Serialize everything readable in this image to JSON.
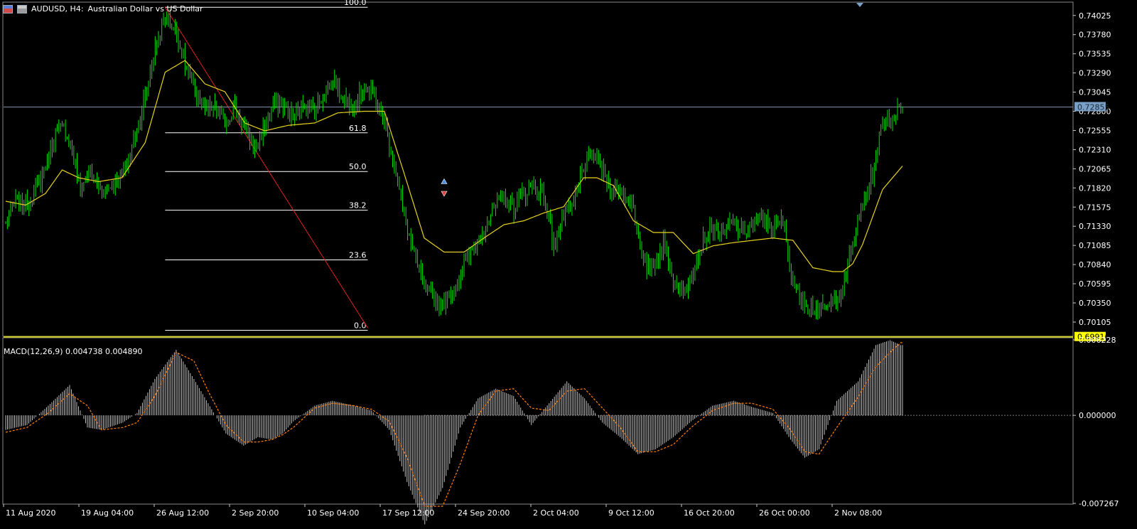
{
  "header": {
    "symbol": "AUDUSD, H4:",
    "description": "Australian Dollar vs US Dollar"
  },
  "macd_header": {
    "label": "MACD(12,26,9) 0.004738 0.004890"
  },
  "colors": {
    "background": "#000000",
    "candle": "#00e000",
    "ma": "#e6d21e",
    "fib": "#ffffff",
    "trend": "#e01e1e",
    "macd_hist": "#c0c0c0",
    "signal": "#ff7f00",
    "current_price_label_bg": "#7aa0c8",
    "fixed_price_label_bg": "#ffff00"
  },
  "chart_data": [
    {
      "type": "candlestick",
      "symbol": "AUDUSD",
      "timeframe": "H4",
      "ylim": [
        0.6995,
        0.7415
      ],
      "y_ticks": [
        "0.74025",
        "0.73780",
        "0.73535",
        "0.73290",
        "0.73045",
        "0.72800",
        "0.72555",
        "0.72310",
        "0.72065",
        "0.71820",
        "0.71575",
        "0.71330",
        "0.71085",
        "0.70840",
        "0.70595",
        "0.70350",
        "0.70105"
      ],
      "x_ticks": [
        "11 Aug 2020",
        "19 Aug 04:00",
        "26 Aug 12:00",
        "2 Sep 20:00",
        "10 Sep 04:00",
        "17 Sep 12:00",
        "24 Sep 20:00",
        "2 Oct 04:00",
        "9 Oct 12:00",
        "16 Oct 20:00",
        "26 Oct 00:00",
        "2 Nov 08:00"
      ],
      "close_anchors": [
        [
          0,
          0.7135
        ],
        [
          6,
          0.7165
        ],
        [
          12,
          0.716
        ],
        [
          18,
          0.7178
        ],
        [
          24,
          0.721
        ],
        [
          30,
          0.725
        ],
        [
          35,
          0.726
        ],
        [
          40,
          0.723
        ],
        [
          45,
          0.718
        ],
        [
          50,
          0.7205
        ],
        [
          55,
          0.7185
        ],
        [
          60,
          0.718
        ],
        [
          66,
          0.719
        ],
        [
          72,
          0.7205
        ],
        [
          78,
          0.725
        ],
        [
          84,
          0.73
        ],
        [
          90,
          0.736
        ],
        [
          96,
          0.74
        ],
        [
          102,
          0.7385
        ],
        [
          108,
          0.734
        ],
        [
          114,
          0.7305
        ],
        [
          120,
          0.728
        ],
        [
          126,
          0.7285
        ],
        [
          132,
          0.7265
        ],
        [
          138,
          0.7285
        ],
        [
          144,
          0.7255
        ],
        [
          150,
          0.723
        ],
        [
          156,
          0.7262
        ],
        [
          162,
          0.729
        ],
        [
          168,
          0.7285
        ],
        [
          174,
          0.727
        ],
        [
          180,
          0.729
        ],
        [
          186,
          0.728
        ],
        [
          192,
          0.7305
        ],
        [
          198,
          0.732
        ],
        [
          204,
          0.7295
        ],
        [
          210,
          0.729
        ],
        [
          216,
          0.731
        ],
        [
          222,
          0.73
        ],
        [
          228,
          0.7265
        ],
        [
          234,
          0.7215
        ],
        [
          240,
          0.7145
        ],
        [
          246,
          0.7095
        ],
        [
          252,
          0.7055
        ],
        [
          258,
          0.704
        ],
        [
          264,
          0.7035
        ],
        [
          270,
          0.705
        ],
        [
          276,
          0.7085
        ],
        [
          282,
          0.7105
        ],
        [
          288,
          0.713
        ],
        [
          294,
          0.7155
        ],
        [
          300,
          0.717
        ],
        [
          306,
          0.7155
        ],
        [
          312,
          0.7175
        ],
        [
          318,
          0.7185
        ],
        [
          324,
          0.7175
        ],
        [
          330,
          0.711
        ],
        [
          336,
          0.7145
        ],
        [
          342,
          0.716
        ],
        [
          348,
          0.721
        ],
        [
          354,
          0.7225
        ],
        [
          360,
          0.72
        ],
        [
          366,
          0.718
        ],
        [
          372,
          0.7175
        ],
        [
          378,
          0.716
        ],
        [
          384,
          0.708
        ],
        [
          390,
          0.7085
        ],
        [
          396,
          0.711
        ],
        [
          402,
          0.7065
        ],
        [
          408,
          0.7045
        ],
        [
          414,
          0.708
        ],
        [
          420,
          0.7115
        ],
        [
          426,
          0.713
        ],
        [
          432,
          0.712
        ],
        [
          438,
          0.714
        ],
        [
          444,
          0.7125
        ],
        [
          450,
          0.7135
        ],
        [
          456,
          0.714
        ],
        [
          462,
          0.713
        ],
        [
          468,
          0.714
        ],
        [
          474,
          0.706
        ],
        [
          480,
          0.704
        ],
        [
          486,
          0.703
        ],
        [
          492,
          0.7025
        ],
        [
          498,
          0.7035
        ],
        [
          504,
          0.7055
        ],
        [
          510,
          0.711
        ],
        [
          516,
          0.716
        ],
        [
          522,
          0.72
        ],
        [
          528,
          0.7265
        ],
        [
          534,
          0.7275
        ],
        [
          540,
          0.7285
        ]
      ],
      "n_candles": 541,
      "moving_average": {
        "anchors": [
          [
            0,
            0.7165
          ],
          [
            12,
            0.716
          ],
          [
            24,
            0.7175
          ],
          [
            34,
            0.7205
          ],
          [
            44,
            0.7195
          ],
          [
            56,
            0.719
          ],
          [
            70,
            0.7195
          ],
          [
            84,
            0.724
          ],
          [
            96,
            0.733
          ],
          [
            108,
            0.7345
          ],
          [
            120,
            0.7315
          ],
          [
            132,
            0.7305
          ],
          [
            144,
            0.7265
          ],
          [
            156,
            0.7255
          ],
          [
            170,
            0.7262
          ],
          [
            186,
            0.7265
          ],
          [
            200,
            0.7278
          ],
          [
            216,
            0.728
          ],
          [
            228,
            0.728
          ],
          [
            240,
            0.72
          ],
          [
            252,
            0.7118
          ],
          [
            264,
            0.71
          ],
          [
            276,
            0.71
          ],
          [
            288,
            0.7118
          ],
          [
            300,
            0.7135
          ],
          [
            312,
            0.714
          ],
          [
            324,
            0.715
          ],
          [
            336,
            0.7158
          ],
          [
            348,
            0.7195
          ],
          [
            356,
            0.7195
          ],
          [
            366,
            0.7185
          ],
          [
            378,
            0.714
          ],
          [
            390,
            0.7125
          ],
          [
            402,
            0.7125
          ],
          [
            414,
            0.7098
          ],
          [
            426,
            0.7108
          ],
          [
            438,
            0.7112
          ],
          [
            450,
            0.7115
          ],
          [
            462,
            0.7118
          ],
          [
            474,
            0.7115
          ],
          [
            486,
            0.708
          ],
          [
            498,
            0.7075
          ],
          [
            504,
            0.7075
          ],
          [
            510,
            0.7085
          ],
          [
            516,
            0.711
          ],
          [
            528,
            0.718
          ],
          [
            540,
            0.721
          ]
        ]
      },
      "fibonacci": {
        "high": 0.7413,
        "low": 0.6992,
        "start_index": 96,
        "end_index": 218,
        "levels": [
          {
            "label": "100.0",
            "value": 0.7413
          },
          {
            "label": "61.8",
            "value": 0.72525
          },
          {
            "label": "50.0",
            "value": 0.7203
          },
          {
            "label": "38.2",
            "value": 0.71535
          },
          {
            "label": "23.6",
            "value": 0.709
          },
          {
            "label": "0.0",
            "value": 0.7
          }
        ]
      },
      "trendline": {
        "from": [
          96,
          0.7413
        ],
        "to": [
          218,
          0.7003
        ]
      },
      "current_price": {
        "label": "0.72855",
        "value": 0.72855
      },
      "fixed_level": {
        "label": "0.69916",
        "value": 0.69916
      },
      "arrows": [
        {
          "index": 264,
          "value": 0.719,
          "kind": "buy"
        },
        {
          "index": 264,
          "value": 0.7175,
          "kind": "sell"
        }
      ]
    },
    {
      "type": "bar",
      "name": "MACD(12,26,9)",
      "ylim": [
        -0.007267,
        0.006228
      ],
      "y_ticks": [
        "0.006228",
        "0.000000",
        "-0.007267"
      ],
      "hist_anchors": [
        [
          0,
          -0.0012
        ],
        [
          12,
          -0.0008
        ],
        [
          24,
          0.0008
        ],
        [
          36,
          0.0025
        ],
        [
          46,
          -0.001
        ],
        [
          54,
          -0.0012
        ],
        [
          66,
          -0.0006
        ],
        [
          74,
          0.0002
        ],
        [
          84,
          0.003
        ],
        [
          96,
          0.0054
        ],
        [
          106,
          0.003
        ],
        [
          114,
          0.001
        ],
        [
          124,
          -0.0015
        ],
        [
          134,
          -0.0025
        ],
        [
          142,
          -0.0018
        ],
        [
          150,
          -0.002
        ],
        [
          156,
          -0.0015
        ],
        [
          162,
          -0.0005
        ],
        [
          174,
          0.0008
        ],
        [
          184,
          0.0012
        ],
        [
          196,
          0.0008
        ],
        [
          206,
          0.0004
        ],
        [
          216,
          -0.0012
        ],
        [
          226,
          -0.0055
        ],
        [
          236,
          -0.009
        ],
        [
          246,
          -0.006
        ],
        [
          256,
          -0.001
        ],
        [
          266,
          0.0014
        ],
        [
          276,
          0.0022
        ],
        [
          286,
          0.0016
        ],
        [
          296,
          -0.0008
        ],
        [
          306,
          0.001
        ],
        [
          316,
          0.0028
        ],
        [
          326,
          0.0014
        ],
        [
          336,
          -0.0006
        ],
        [
          346,
          -0.0018
        ],
        [
          356,
          -0.0032
        ],
        [
          366,
          -0.0028
        ],
        [
          376,
          -0.0018
        ],
        [
          386,
          -0.0005
        ],
        [
          398,
          0.0008
        ],
        [
          410,
          0.0012
        ],
        [
          420,
          0.0007
        ],
        [
          432,
          0.0002
        ],
        [
          442,
          -0.002
        ],
        [
          450,
          -0.0035
        ],
        [
          458,
          -0.0028
        ],
        [
          468,
          0.0012
        ],
        [
          480,
          0.0028
        ],
        [
          490,
          0.0058
        ],
        [
          498,
          0.0062
        ],
        [
          504,
          0.0058
        ]
      ],
      "signal_anchors": [
        [
          0,
          -0.0014
        ],
        [
          12,
          -0.001
        ],
        [
          24,
          0.0002
        ],
        [
          36,
          0.0018
        ],
        [
          46,
          0.0008
        ],
        [
          54,
          -0.0012
        ],
        [
          66,
          -0.001
        ],
        [
          74,
          -0.0006
        ],
        [
          84,
          0.0016
        ],
        [
          96,
          0.0052
        ],
        [
          106,
          0.0045
        ],
        [
          114,
          0.002
        ],
        [
          124,
          -0.0008
        ],
        [
          134,
          -0.0022
        ],
        [
          142,
          -0.0022
        ],
        [
          150,
          -0.002
        ],
        [
          156,
          -0.0016
        ],
        [
          162,
          -0.001
        ],
        [
          174,
          0.0006
        ],
        [
          184,
          0.001
        ],
        [
          196,
          0.0008
        ],
        [
          206,
          0.0005
        ],
        [
          216,
          -0.0005
        ],
        [
          226,
          -0.0035
        ],
        [
          236,
          -0.0075
        ],
        [
          246,
          -0.0075
        ],
        [
          256,
          -0.004
        ],
        [
          266,
          0.0
        ],
        [
          276,
          0.002
        ],
        [
          286,
          0.0022
        ],
        [
          296,
          0.0006
        ],
        [
          306,
          0.0004
        ],
        [
          316,
          0.002
        ],
        [
          326,
          0.0022
        ],
        [
          336,
          0.0006
        ],
        [
          346,
          -0.001
        ],
        [
          356,
          -0.003
        ],
        [
          366,
          -0.003
        ],
        [
          376,
          -0.0024
        ],
        [
          386,
          -0.001
        ],
        [
          398,
          0.0004
        ],
        [
          410,
          0.001
        ],
        [
          420,
          0.001
        ],
        [
          432,
          0.0005
        ],
        [
          442,
          -0.0012
        ],
        [
          450,
          -0.003
        ],
        [
          458,
          -0.0032
        ],
        [
          468,
          -0.001
        ],
        [
          480,
          0.0015
        ],
        [
          490,
          0.004
        ],
        [
          498,
          0.0052
        ],
        [
          504,
          0.006
        ]
      ]
    }
  ]
}
